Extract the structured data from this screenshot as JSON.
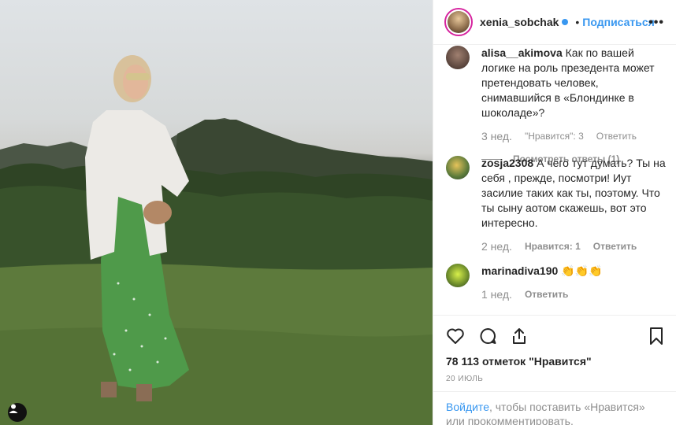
{
  "post": {
    "username": "xenia_sobchak",
    "follow_label": "Подписаться",
    "dot": "•",
    "more_label": "•••"
  },
  "comments": [
    {
      "user": "alisa__akimova",
      "text": "Как по вашей логике на роль презедента может претендовать человек, снимавшийся в «Блондинке в шоколаде»?",
      "time": "3 нед.",
      "likes": "\"Нравится\": 3",
      "reply": "Ответить",
      "view_replies": "Посмотреть ответы (1)"
    },
    {
      "user": "zosja2308",
      "text": "А чего тут думать? Ты на себя , прежде, посмотри! Иут засилие таких как ты, поэтому. Что ты сыну аотом скажешь, вот это интересно.",
      "time": "2 нед.",
      "likes": "Нравится: 1",
      "reply": "Ответить"
    },
    {
      "user": "marinadiva190",
      "text": "👏👏👏",
      "time": "1 нед.",
      "reply": "Ответить"
    }
  ],
  "actions": {
    "likes_total": "78 113 отметок \"Нравится\"",
    "date": "20 ИЮЛЬ"
  },
  "login": {
    "link": "Войдите",
    "rest": ", чтобы поставить «Нравится» или прокомментировать."
  }
}
